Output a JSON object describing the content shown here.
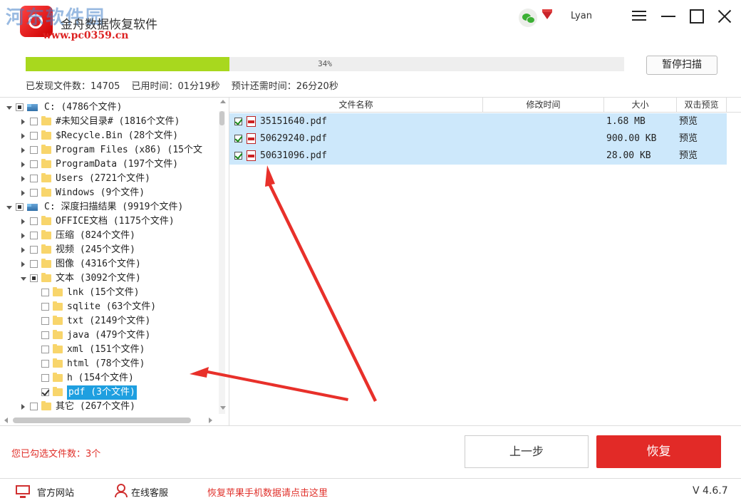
{
  "watermark": {
    "text": "河东软件园",
    "url": "www.pc0359.cn"
  },
  "app": {
    "title": "金舟数据恢复软件",
    "username": "Lyan"
  },
  "scan": {
    "progress_percent": 34,
    "progress_label": "34%",
    "pause_label": "暂停扫描",
    "found_files": "已发现文件数：14705",
    "elapsed": "已用时间：01分19秒",
    "remaining": "预计还需时间：26分20秒"
  },
  "tree": [
    {
      "label": "C:   (4786个文件)",
      "level": 0,
      "expand": "down",
      "check": "partial",
      "icon": "drive"
    },
    {
      "label": "#未知父目录#   (1816个文件)",
      "level": 1,
      "expand": "right",
      "check": "none",
      "icon": "folder"
    },
    {
      "label": "$Recycle.Bin   (28个文件)",
      "level": 1,
      "expand": "right",
      "check": "none",
      "icon": "folder"
    },
    {
      "label": "Program Files (x86)   (15个文",
      "level": 1,
      "expand": "right",
      "check": "none",
      "icon": "folder"
    },
    {
      "label": "ProgramData   (197个文件)",
      "level": 1,
      "expand": "right",
      "check": "none",
      "icon": "folder"
    },
    {
      "label": "Users   (2721个文件)",
      "level": 1,
      "expand": "right",
      "check": "none",
      "icon": "folder"
    },
    {
      "label": "Windows   (9个文件)",
      "level": 1,
      "expand": "right",
      "check": "none",
      "icon": "folder"
    },
    {
      "label": "C: 深度扫描结果   (9919个文件)",
      "level": 0,
      "expand": "down",
      "check": "partial",
      "icon": "drive"
    },
    {
      "label": "OFFICE文档   (1175个文件)",
      "level": 1,
      "expand": "right",
      "check": "none",
      "icon": "folder"
    },
    {
      "label": "压缩   (824个文件)",
      "level": 1,
      "expand": "right",
      "check": "none",
      "icon": "folder"
    },
    {
      "label": "视频   (245个文件)",
      "level": 1,
      "expand": "right",
      "check": "none",
      "icon": "folder"
    },
    {
      "label": "图像   (4316个文件)",
      "level": 1,
      "expand": "right",
      "check": "none",
      "icon": "folder"
    },
    {
      "label": "文本   (3092个文件)",
      "level": 1,
      "expand": "down",
      "check": "partial",
      "icon": "folder"
    },
    {
      "label": "lnk   (15个文件)",
      "level": 2,
      "expand": "none",
      "check": "none",
      "icon": "folder"
    },
    {
      "label": "sqlite   (63个文件)",
      "level": 2,
      "expand": "none",
      "check": "none",
      "icon": "folder"
    },
    {
      "label": "txt   (2149个文件)",
      "level": 2,
      "expand": "none",
      "check": "none",
      "icon": "folder"
    },
    {
      "label": "java   (479个文件)",
      "level": 2,
      "expand": "none",
      "check": "none",
      "icon": "folder"
    },
    {
      "label": "xml   (151个文件)",
      "level": 2,
      "expand": "none",
      "check": "none",
      "icon": "folder"
    },
    {
      "label": "html   (78个文件)",
      "level": 2,
      "expand": "none",
      "check": "none",
      "icon": "folder"
    },
    {
      "label": "h   (154个文件)",
      "level": 2,
      "expand": "none",
      "check": "none",
      "icon": "folder"
    },
    {
      "label": "pdf   (3个文件)",
      "level": 2,
      "expand": "none",
      "check": "checked",
      "icon": "folder",
      "selected": true
    },
    {
      "label": "其它   (267个文件)",
      "level": 1,
      "expand": "right",
      "check": "none",
      "icon": "folder"
    }
  ],
  "file_list": {
    "columns": [
      "文件名称",
      "修改时间",
      "大小",
      "双击预览"
    ],
    "rows": [
      {
        "name": "35151640.pdf",
        "modified": "",
        "size": "1.68 MB",
        "preview": "预览"
      },
      {
        "name": "50629240.pdf",
        "modified": "",
        "size": "900.00 KB",
        "preview": "预览"
      },
      {
        "name": "50631096.pdf",
        "modified": "",
        "size": "28.00 KB",
        "preview": "预览"
      }
    ]
  },
  "bottom": {
    "selected_count": "您已勾选文件数：3个",
    "prev_label": "上一步",
    "recover_label": "恢复"
  },
  "footer": {
    "website": "官方网站",
    "support": "在线客服",
    "ios_link": "恢复苹果手机数据请点击这里",
    "version": "V 4.6.7"
  },
  "colors": {
    "progress": "#a8d81e",
    "recover_button": "#e22a27",
    "row_highlight": "#cde8fb",
    "tree_selected": "#1e9fe0",
    "accent_red": "#e0302a"
  }
}
